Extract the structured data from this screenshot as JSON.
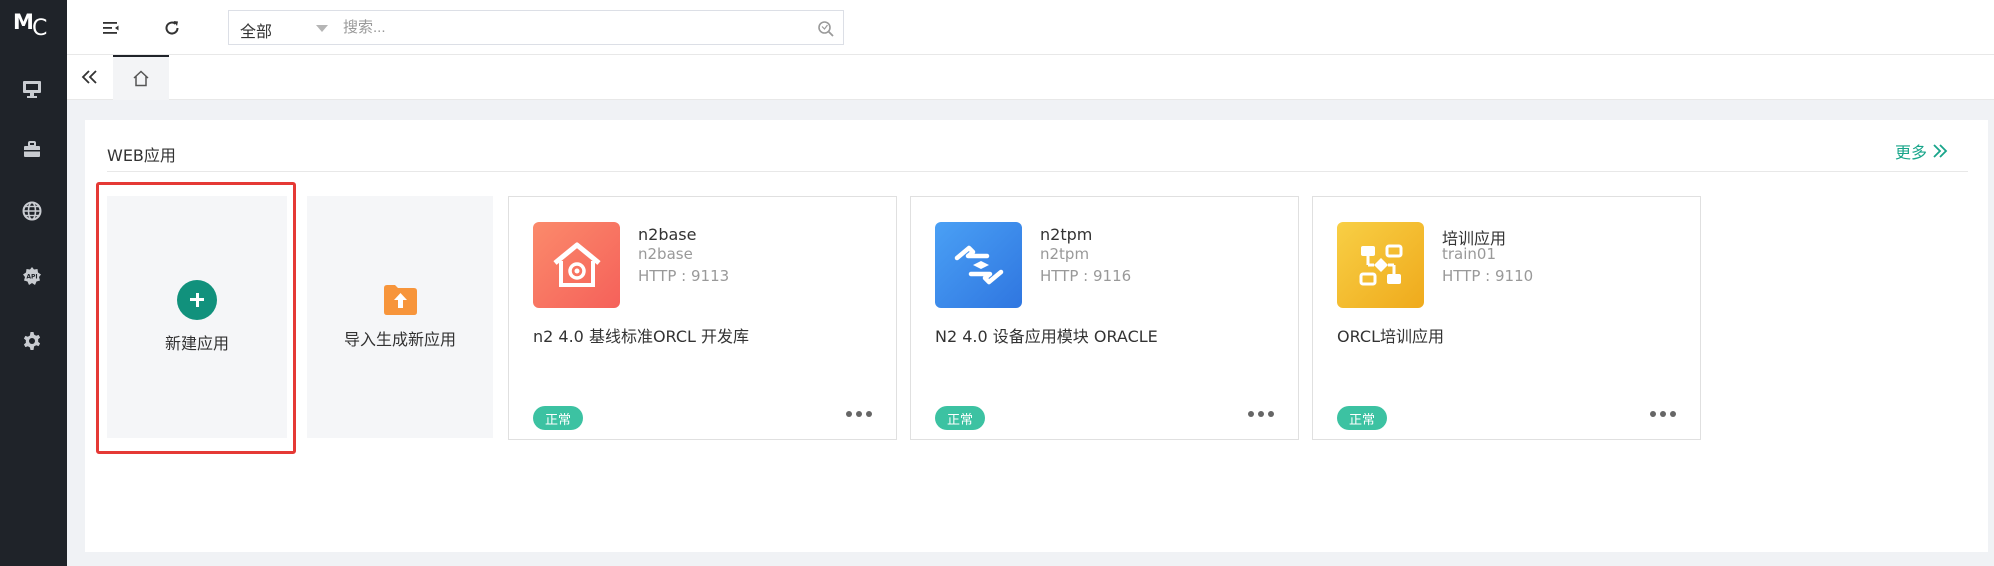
{
  "logo": {
    "m": "M",
    "c": "C"
  },
  "sidebar": {
    "items": [
      {
        "icon": "monitor-icon"
      },
      {
        "icon": "briefcase-icon"
      },
      {
        "icon": "globe-icon"
      },
      {
        "icon": "api-icon",
        "label": "API"
      },
      {
        "icon": "gear-icon"
      }
    ]
  },
  "topbar": {
    "search_scope": "全部",
    "search_placeholder": "搜索..."
  },
  "panel": {
    "title": "WEB应用",
    "more_label": "更多"
  },
  "tiles": {
    "new_app_label": "新建应用",
    "import_label": "导入生成新应用"
  },
  "apps": [
    {
      "name": "n2base",
      "code": "n2base",
      "http": "HTTP : 9113",
      "desc": "n2 4.0 基线标准ORCL 开发库",
      "status": "正常",
      "icon": "house-icon",
      "color": "#f96f5f"
    },
    {
      "name": "n2tpm",
      "code": "n2tpm",
      "http": "HTTP : 9116",
      "desc": "N2 4.0 设备应用模块 ORACLE",
      "status": "正常",
      "icon": "hands-exchange-icon",
      "color": "#3c87ea"
    },
    {
      "name": "培训应用",
      "code": "train01",
      "http": "HTTP : 9110",
      "desc": "ORCL培训应用",
      "status": "正常",
      "icon": "flowchart-icon",
      "color": "#f0b622"
    }
  ],
  "colors": {
    "sidebar_bg": "#1f2329",
    "accent": "#11917c",
    "status": "#3cc2a2",
    "highlight": "#e53935"
  }
}
